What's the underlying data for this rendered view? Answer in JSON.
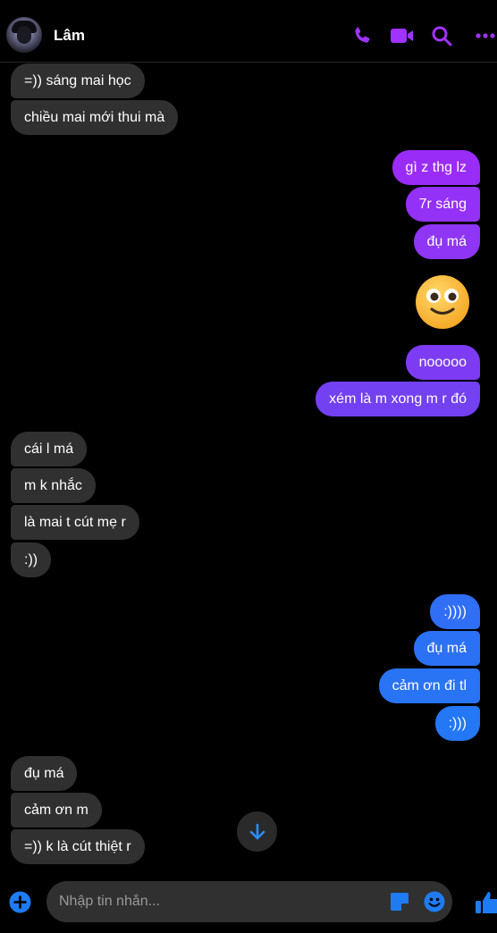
{
  "header": {
    "contact_name": "Lâm",
    "accent_color": "#a033ff"
  },
  "messages": {
    "m01": "=)) sáng mai học",
    "m02": "chiều mai mới thui mà",
    "m03": "gì z thg lz",
    "m04": "7r sáng",
    "m05": "đụ má",
    "m06": "nooooo",
    "m07": "xém là m xong m r đó",
    "m08": "cái l má",
    "m09": "m k nhắc",
    "m10": "là mai t cút mẹ r",
    "m11": ":))",
    "m12": ":))))",
    "m13": "đụ má",
    "m14": "cảm ơn đi tl",
    "m15": ":)))",
    "m16": "đụ má",
    "m17": "cảm ơn m",
    "m18": "=)) k là cút thiệt r"
  },
  "composer": {
    "placeholder": "Nhập tin nhắn..."
  },
  "colors": {
    "incoming_bubble": "#303030",
    "outgoing_purple": "#9a2cf7",
    "outgoing_violet": "#7a3ef2",
    "outgoing_blue": "#2a73f5",
    "composer_icon_blue": "#1f7bf2"
  }
}
